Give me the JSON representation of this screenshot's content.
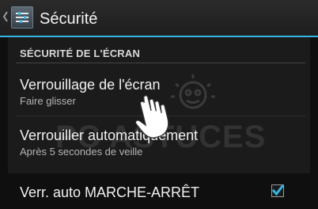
{
  "header": {
    "title": "Sécurité",
    "accent_color": "#33b5e5",
    "icon": "settings-sliders-icon"
  },
  "section": {
    "title": "SÉCURITÉ DE L'ÉCRAN"
  },
  "preferences": [
    {
      "title": "Verrouillage de l'écran",
      "summary": "Faire glisser"
    },
    {
      "title": "Verrouiller automatiquement",
      "summary": "Après 5 secondes de veille"
    },
    {
      "title": "Verr. auto MARCHE-ARRÊT",
      "checked": true
    }
  ],
  "watermark": {
    "text": "PC ASTUCES",
    "icon": "lightbulb-face-icon"
  },
  "cursor": {
    "icon": "hand-pointer-icon"
  }
}
